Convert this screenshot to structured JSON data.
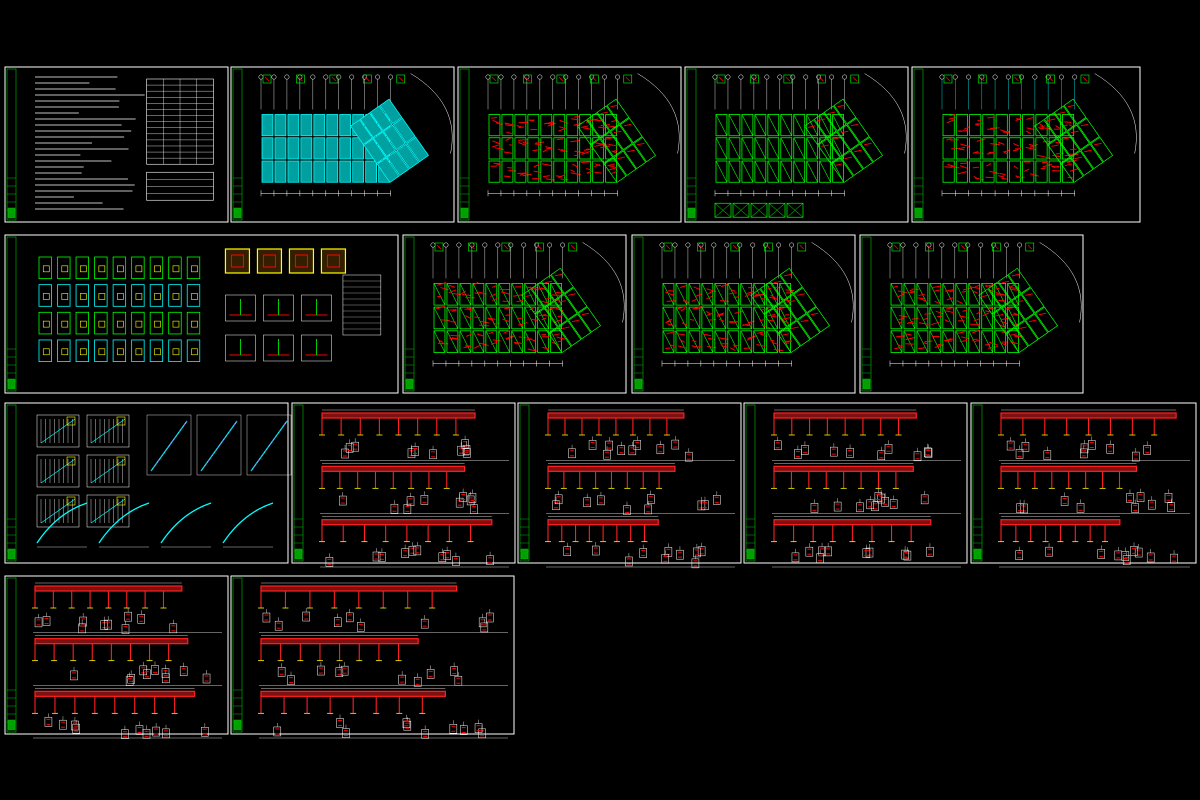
{
  "colors": {
    "background": "#000000",
    "sheet_border": "#ffffff",
    "title_block": "#00c000",
    "wall": "#00ff00",
    "grid": "#00ffff",
    "rebar": "#ff0000",
    "beam": "#ff2020",
    "hatch": "#ffff00",
    "text": "#ffffff",
    "accent": "#ff00ff"
  },
  "sheets": [
    {
      "kind": "notes"
    },
    {
      "kind": "plan-cyan"
    },
    {
      "kind": "plan-red"
    },
    {
      "kind": "plan-green"
    },
    {
      "kind": "plan-grid"
    },
    {
      "kind": "foundation"
    },
    {
      "kind": "plan-mixed"
    },
    {
      "kind": "plan-mixed"
    },
    {
      "kind": "plan-mixed"
    },
    {
      "kind": "stairs"
    },
    {
      "kind": "beams"
    },
    {
      "kind": "beams"
    },
    {
      "kind": "beams"
    },
    {
      "kind": "beams"
    },
    {
      "kind": "beams"
    },
    {
      "kind": "beams"
    }
  ]
}
